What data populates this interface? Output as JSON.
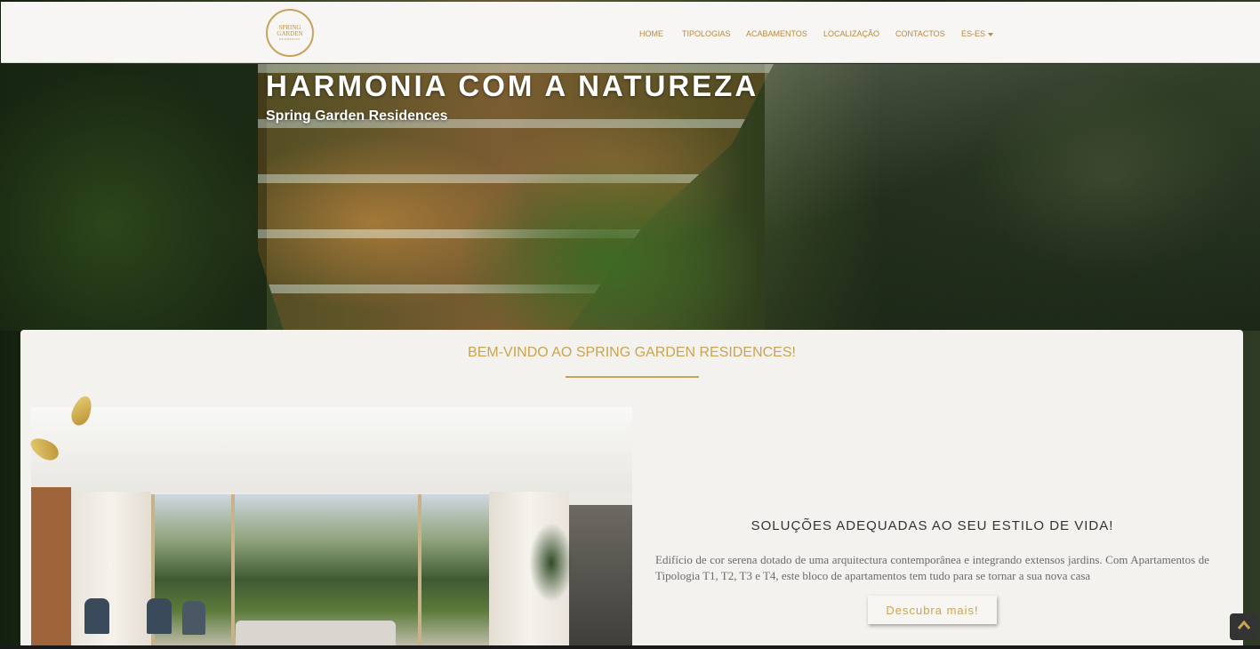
{
  "brand": {
    "logo_line1": "SPRING",
    "logo_line2": "GARDEN",
    "logo_line3": "RESIDENCES"
  },
  "nav": {
    "items": [
      "HOME",
      "TIPOLOGIAS",
      "ACABAMENTOS",
      "LOCALIZAÇÃO",
      "CONTACTOS"
    ],
    "language": "ES-ES"
  },
  "hero": {
    "title": "HARMONIA COM A NATUREZA",
    "subtitle": "Spring Garden Residences"
  },
  "welcome": {
    "heading": "BEM-VINDO AO SPRING GARDEN RESIDENCES!"
  },
  "feature": {
    "heading": "SOLUÇÕES ADEQUADAS AO SEU ESTILO DE VIDA!",
    "description": "Edifício de cor serena dotado de uma arquitectura contemporânea e integrando extensos jardins. Com Apartamentos de Tipologia T1, T2, T3 e T4, este bloco de apartamentos tem tudo para se tornar a sua nova casa",
    "button_label": "Descubra mais!"
  },
  "icons": {
    "scroll_top": "chevron-up-icon"
  },
  "colors": {
    "accent": "#c9a451",
    "nav_text": "#b98a3d",
    "card_bg": "#f4f2ef"
  }
}
